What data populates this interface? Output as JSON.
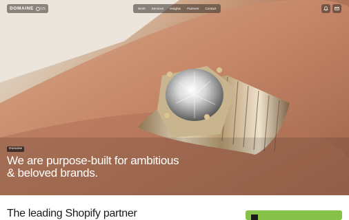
{
  "header": {
    "logo_text": "DOMAINE",
    "logo_badge": "US",
    "nav_items": [
      "Work",
      "Services",
      "Insights",
      "Partners",
      "Contact"
    ]
  },
  "icons": {
    "notification": "bell-icon",
    "contact": "mail-icon"
  },
  "hero": {
    "tag": "Domaine",
    "headline": "We are purpose-built for ambitious & beloved brands."
  },
  "section": {
    "title": "The leading Shopify partner"
  },
  "colors": {
    "promo_accent": "#86c24a",
    "text_dark": "#1a1a1a"
  }
}
